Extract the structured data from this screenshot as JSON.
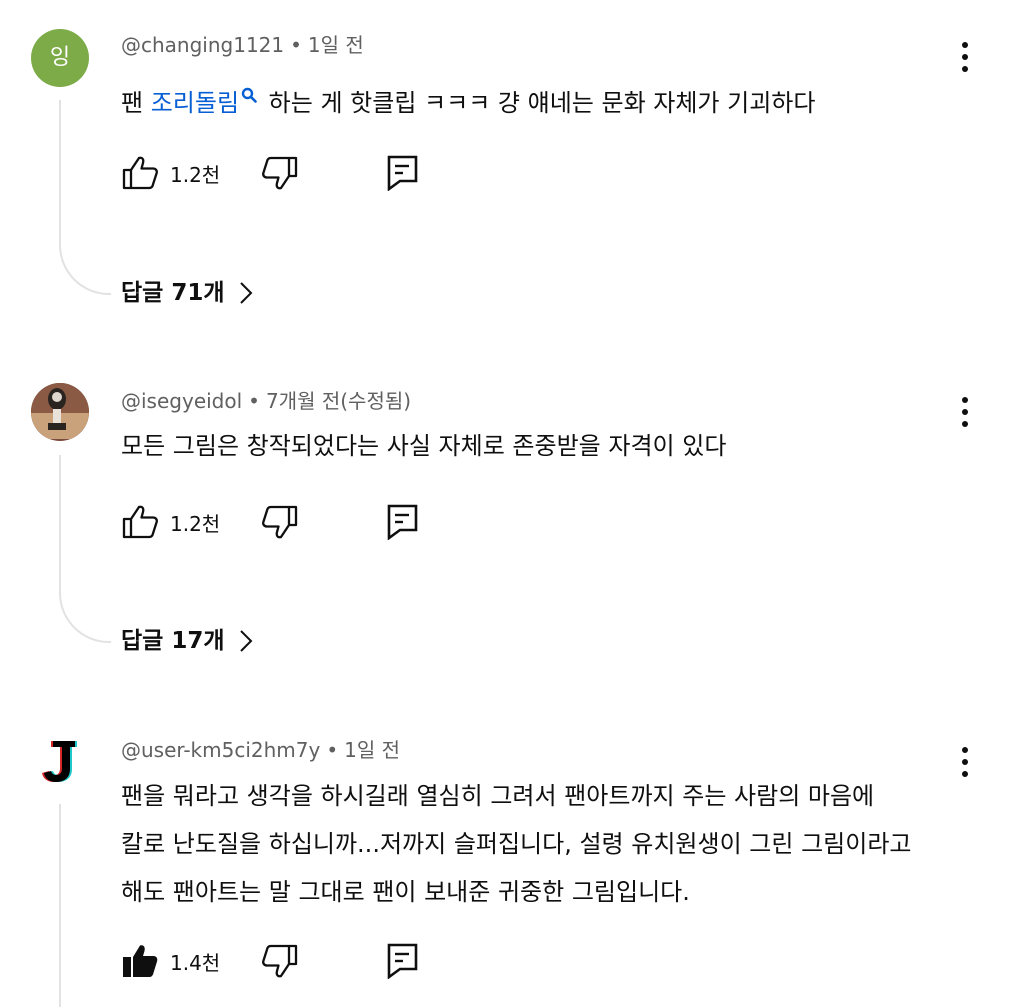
{
  "comments": [
    {
      "avatar_letter": "잉",
      "avatar_color": "#7cab48",
      "author": "@changing1121",
      "separator": "•",
      "time": "1일 전",
      "text_before": "팬 ",
      "hashtag": "조리돌림",
      "text_after": " 하는 게 핫클립 ㅋㅋㅋ 걍 얘네는 문화 자체가 기괴하다",
      "likes": "1.2천",
      "liked": false,
      "replies_label": "답글 71개"
    },
    {
      "avatar_letter": "",
      "avatar_icon": "trophy-photo",
      "author": "@isegyeidol",
      "separator": "•",
      "time": "7개월 전(수정됨)",
      "text": "모든 그림은 창작되었다는 사실 자체로 존중받을 자격이 있다",
      "likes": "1.2천",
      "liked": false,
      "replies_label": "답글 17개"
    },
    {
      "avatar_letter": "J",
      "author": "@user-km5ci2hm7y",
      "separator": "•",
      "time": "1일 전",
      "lines": [
        "팬을 뭐라고 생각을 하시길래 열심히 그려서 팬아트까지 주는 사람의 마음에",
        "칼로 난도질을 하십니까...저까지 슬퍼집니다, 설령 유치원생이 그린 그림이라고",
        "해도 팬아트는 말 그대로 팬이 보내준 귀중한 그림입니다."
      ],
      "likes": "1.4천",
      "liked": true
    }
  ],
  "colors": {
    "hashtag": "#065fd4",
    "meta": "#606060",
    "thread": "#e2e2e2"
  }
}
